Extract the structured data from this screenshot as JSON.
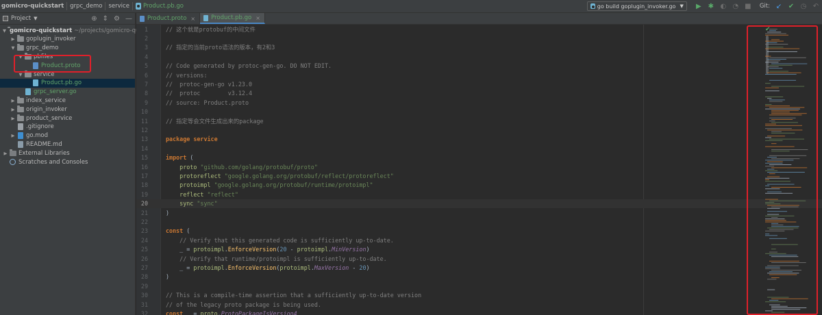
{
  "breadcrumbs": [
    {
      "label": "gomicro-quickstart",
      "kind": "project"
    },
    {
      "label": "grpc_demo",
      "kind": "folder"
    },
    {
      "label": "service",
      "kind": "folder"
    },
    {
      "label": "Product.pb.go",
      "kind": "file"
    }
  ],
  "toolbar": {
    "run_config": "go build goplugin_invoker.go",
    "git_label": "Git:",
    "icons": [
      "run-icon",
      "debug-icon",
      "coverage-icon",
      "profile-icon",
      "stop-icon",
      "vcs-update-icon",
      "vcs-commit-icon",
      "vcs-history-icon",
      "revert-icon"
    ]
  },
  "project_panel": {
    "title": "Project",
    "tree": [
      {
        "label": "gomicro-quickstart",
        "suffix": "~/projects/gomicro-quic",
        "indent": 0,
        "arrow": "down",
        "icon": "folder",
        "style": "bold"
      },
      {
        "label": "goplugin_invoker",
        "indent": 1,
        "arrow": "right",
        "icon": "folder"
      },
      {
        "label": "grpc_demo",
        "indent": 1,
        "arrow": "down",
        "icon": "folder"
      },
      {
        "label": "pbfiles",
        "indent": 2,
        "arrow": "down",
        "icon": "folder"
      },
      {
        "label": "Product.proto",
        "indent": 3,
        "arrow": "",
        "icon": "proto",
        "style": "green"
      },
      {
        "label": "service",
        "indent": 2,
        "arrow": "down",
        "icon": "folder"
      },
      {
        "label": "Product.pb.go",
        "indent": 3,
        "arrow": "",
        "icon": "go",
        "style": "green",
        "selected": true
      },
      {
        "label": "grpc_server.go",
        "indent": 2,
        "arrow": "",
        "icon": "go",
        "style": "green"
      },
      {
        "label": "index_service",
        "indent": 1,
        "arrow": "right",
        "icon": "folder"
      },
      {
        "label": "origin_invoker",
        "indent": 1,
        "arrow": "right",
        "icon": "folder"
      },
      {
        "label": "product_service",
        "indent": 1,
        "arrow": "right",
        "icon": "folder"
      },
      {
        "label": ".gitignore",
        "indent": 1,
        "arrow": "",
        "icon": "plain"
      },
      {
        "label": "go.mod",
        "indent": 1,
        "arrow": "right",
        "icon": "gomod"
      },
      {
        "label": "README.md",
        "indent": 1,
        "arrow": "",
        "icon": "md"
      },
      {
        "label": "External Libraries",
        "indent": 0,
        "arrow": "right",
        "icon": "lib"
      },
      {
        "label": "Scratches and Consoles",
        "indent": 0,
        "arrow": "",
        "icon": "scratch"
      }
    ]
  },
  "tabs": [
    {
      "label": "Product.proto",
      "active": false,
      "icon": "proto"
    },
    {
      "label": "Product.pb.go",
      "active": true,
      "icon": "go"
    }
  ],
  "editor": {
    "current_line": 20,
    "lines": [
      {
        "n": 1,
        "tokens": [
          [
            "comment",
            "// 这个就是protobuf的中间文件"
          ]
        ]
      },
      {
        "n": 2,
        "tokens": []
      },
      {
        "n": 3,
        "tokens": [
          [
            "comment",
            "// 指定的当前proto语法的版本，有2和3"
          ]
        ]
      },
      {
        "n": 4,
        "tokens": []
      },
      {
        "n": 5,
        "tokens": [
          [
            "comment",
            "// Code generated by protoc-gen-go. DO NOT EDIT."
          ]
        ]
      },
      {
        "n": 6,
        "tokens": [
          [
            "comment",
            "// versions:"
          ]
        ]
      },
      {
        "n": 7,
        "tokens": [
          [
            "comment",
            "//  protoc-gen-go v1.23.0"
          ]
        ]
      },
      {
        "n": 8,
        "tokens": [
          [
            "comment",
            "//  protoc        v3.12.4"
          ]
        ]
      },
      {
        "n": 9,
        "tokens": [
          [
            "comment",
            "// source: Product.proto"
          ]
        ]
      },
      {
        "n": 10,
        "tokens": []
      },
      {
        "n": 11,
        "tokens": [
          [
            "comment",
            "// 指定等会文件生成出来的package"
          ]
        ]
      },
      {
        "n": 12,
        "tokens": []
      },
      {
        "n": 13,
        "tokens": [
          [
            "kw",
            "package "
          ],
          [
            "kw",
            "service"
          ]
        ]
      },
      {
        "n": 14,
        "tokens": []
      },
      {
        "n": 15,
        "tokens": [
          [
            "kw",
            "import "
          ],
          [
            "paren",
            "("
          ]
        ]
      },
      {
        "n": 16,
        "tokens": [
          [
            "plain",
            "    "
          ],
          [
            "pkg",
            "proto "
          ],
          [
            "str",
            "\"github.com/golang/protobuf/proto\""
          ]
        ]
      },
      {
        "n": 17,
        "tokens": [
          [
            "plain",
            "    "
          ],
          [
            "pkg",
            "protoreflect "
          ],
          [
            "str",
            "\"google.golang.org/protobuf/reflect/protoreflect\""
          ]
        ]
      },
      {
        "n": 18,
        "tokens": [
          [
            "plain",
            "    "
          ],
          [
            "pkg",
            "protoimpl "
          ],
          [
            "str",
            "\"google.golang.org/protobuf/runtime/protoimpl\""
          ]
        ]
      },
      {
        "n": 19,
        "tokens": [
          [
            "plain",
            "    "
          ],
          [
            "pkg",
            "reflect "
          ],
          [
            "str",
            "\"reflect\""
          ]
        ]
      },
      {
        "n": 20,
        "tokens": [
          [
            "plain",
            "    "
          ],
          [
            "pkg",
            "sync "
          ],
          [
            "str",
            "\"sync\""
          ]
        ]
      },
      {
        "n": 21,
        "tokens": [
          [
            "paren",
            ")"
          ]
        ]
      },
      {
        "n": 22,
        "tokens": []
      },
      {
        "n": 23,
        "tokens": [
          [
            "kw",
            "const "
          ],
          [
            "paren",
            "("
          ]
        ]
      },
      {
        "n": 24,
        "tokens": [
          [
            "plain",
            "    "
          ],
          [
            "comment",
            "// Verify that this generated code is sufficiently up-to-date."
          ]
        ]
      },
      {
        "n": 25,
        "tokens": [
          [
            "plain",
            "    _ = "
          ],
          [
            "pkg",
            "protoimpl"
          ],
          [
            "plain",
            "."
          ],
          [
            "fn",
            "EnforceVersion"
          ],
          [
            "plain",
            "("
          ],
          [
            "num",
            "20"
          ],
          [
            "plain",
            " - "
          ],
          [
            "pkg",
            "protoimpl"
          ],
          [
            "plain",
            "."
          ],
          [
            "const",
            "MinVersion"
          ],
          [
            "plain",
            ")"
          ]
        ]
      },
      {
        "n": 26,
        "tokens": [
          [
            "plain",
            "    "
          ],
          [
            "comment",
            "// Verify that runtime/protoimpl is sufficiently up-to-date."
          ]
        ]
      },
      {
        "n": 27,
        "tokens": [
          [
            "plain",
            "    _ = "
          ],
          [
            "pkg",
            "protoimpl"
          ],
          [
            "plain",
            "."
          ],
          [
            "fn",
            "EnforceVersion"
          ],
          [
            "plain",
            "("
          ],
          [
            "pkg",
            "protoimpl"
          ],
          [
            "plain",
            "."
          ],
          [
            "const",
            "MaxVersion"
          ],
          [
            "plain",
            " - "
          ],
          [
            "num",
            "20"
          ],
          [
            "plain",
            ")"
          ]
        ]
      },
      {
        "n": 28,
        "tokens": [
          [
            "paren",
            ")"
          ]
        ]
      },
      {
        "n": 29,
        "tokens": []
      },
      {
        "n": 30,
        "tokens": [
          [
            "comment",
            "// This is a compile-time assertion that a sufficiently up-to-date version"
          ]
        ]
      },
      {
        "n": 31,
        "tokens": [
          [
            "comment",
            "// of the legacy proto package is being used."
          ]
        ]
      },
      {
        "n": 32,
        "tokens": [
          [
            "kw",
            "const "
          ],
          [
            "plain",
            "_ = "
          ],
          [
            "pkg",
            "proto"
          ],
          [
            "plain",
            "."
          ],
          [
            "const",
            "ProtoPackageIsVersion4"
          ]
        ]
      }
    ]
  },
  "colors": {
    "accent_highlight": "#e0202a",
    "background": "#2b2b2b",
    "panel": "#3c3f41",
    "selection": "#0d293e"
  }
}
